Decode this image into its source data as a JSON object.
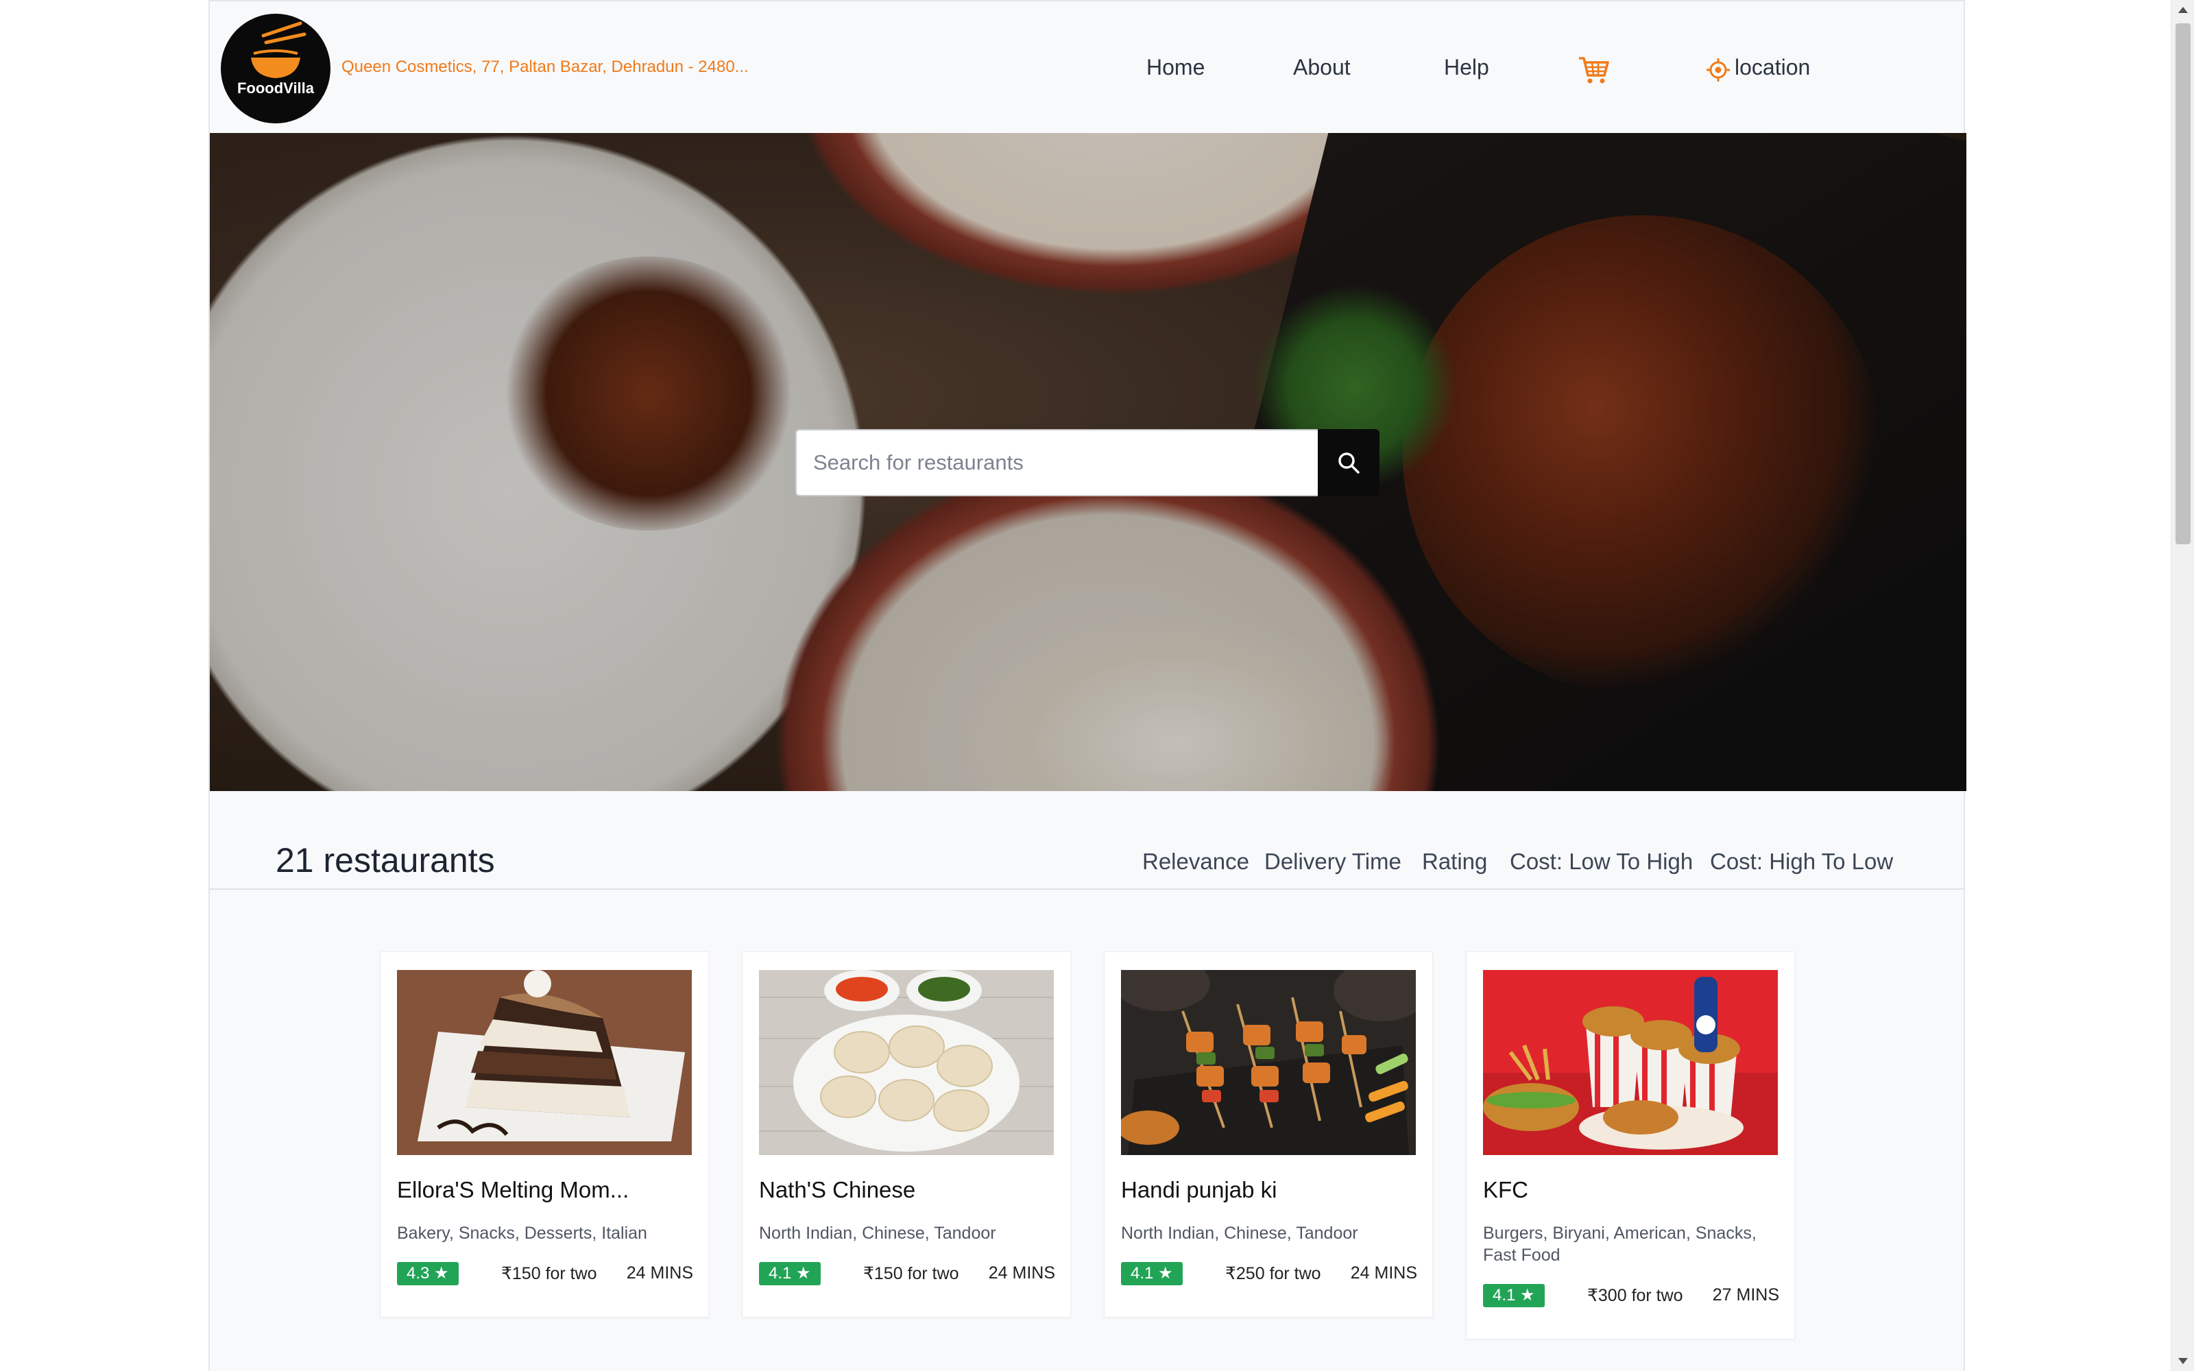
{
  "header": {
    "logo_text": "FooodVilla",
    "address": "Queen Cosmetics, 77, Paltan Bazar, Dehradun - 2480...",
    "nav": {
      "home": "Home",
      "about": "About",
      "help": "Help",
      "location": "location"
    },
    "icons": {
      "cart": "cart-icon",
      "location": "target-icon"
    },
    "accent_color": "#f07a1a"
  },
  "search": {
    "placeholder": "Search for restaurants",
    "value": ""
  },
  "results": {
    "count_label": "21 restaurants",
    "sort_options": [
      "Relevance",
      "Delivery Time",
      "Rating",
      "Cost: Low To High",
      "Cost: High To Low"
    ]
  },
  "restaurants": [
    {
      "name": "Ellora'S Melting Mom...",
      "cuisines": "Bakery, Snacks, Desserts, Italian",
      "rating": "4.3 ★",
      "cost": "₹150 for two",
      "time": "24 MINS"
    },
    {
      "name": "Nath'S Chinese",
      "cuisines": "North Indian, Chinese, Tandoor",
      "rating": "4.1 ★",
      "cost": "₹150 for two",
      "time": "24 MINS"
    },
    {
      "name": "Handi punjab ki",
      "cuisines": "North Indian, Chinese, Tandoor",
      "rating": "4.1 ★",
      "cost": "₹250 for two",
      "time": "24 MINS"
    },
    {
      "name": "KFC",
      "cuisines": "Burgers, Biryani, American, Snacks, Fast Food",
      "rating": "4.1 ★",
      "cost": "₹300 for two",
      "time": "27 MINS"
    }
  ],
  "colors": {
    "rating_badge": "#22a457",
    "brand_orange": "#f07a1a"
  }
}
